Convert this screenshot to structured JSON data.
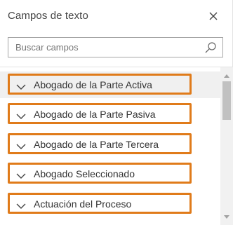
{
  "panel": {
    "title": "Campos de texto",
    "close_icon": "close-icon"
  },
  "search": {
    "placeholder": "Buscar campos",
    "value": "",
    "icon": "search-icon"
  },
  "fields": [
    {
      "label": "Abogado de la Parte Activa",
      "icon": "chevron-down-icon"
    },
    {
      "label": "Abogado de la Parte Pasiva",
      "icon": "chevron-down-icon"
    },
    {
      "label": "Abogado de la Parte Tercera",
      "icon": "chevron-down-icon"
    },
    {
      "label": "Abogado Seleccionado",
      "icon": "chevron-down-icon"
    },
    {
      "label": "Actuación del Proceso",
      "icon": "chevron-down-icon"
    }
  ],
  "colors": {
    "highlight_border": "#e07b1a",
    "first_row_background": "#f0f0f0"
  }
}
